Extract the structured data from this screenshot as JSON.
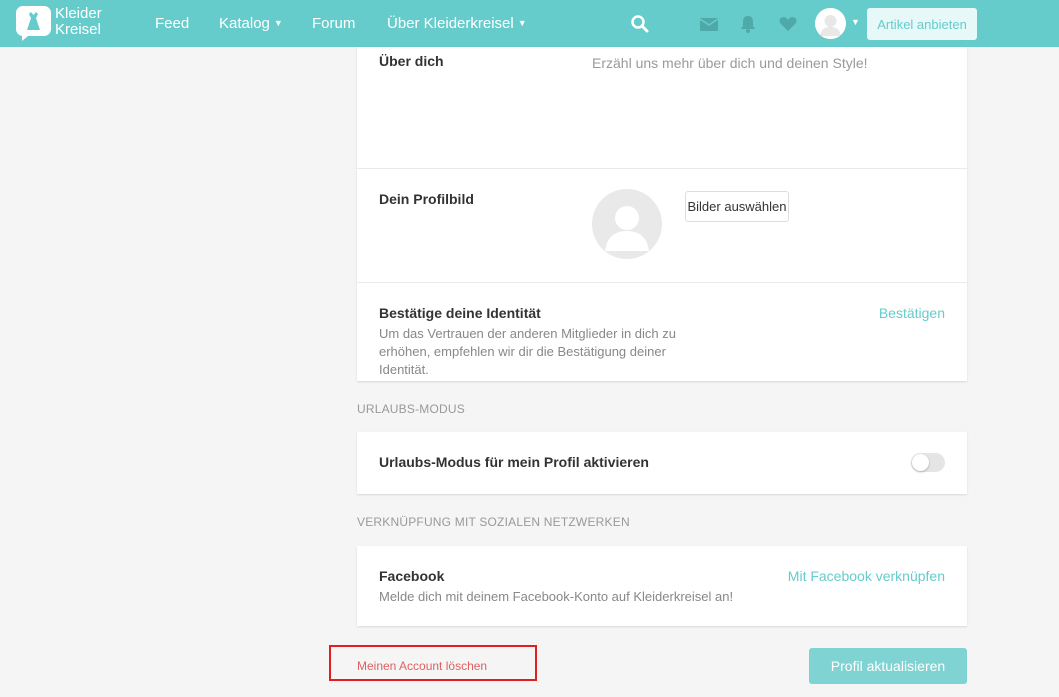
{
  "nav": {
    "logo_line1": "Kleider",
    "logo_line2": "Kreisel",
    "feed": "Feed",
    "catalog": "Katalog",
    "forum": "Forum",
    "about": "Über Kleiderkreisel",
    "sell_button": "Artikel anbieten",
    "icons": [
      "search-icon",
      "mail-icon",
      "bell-icon",
      "heart-icon"
    ]
  },
  "about": {
    "label": "Über dich",
    "placeholder": "Erzähl uns mehr über dich und deinen Style!"
  },
  "profile_picture": {
    "label": "Dein Profilbild",
    "button": "Bilder auswählen"
  },
  "identity": {
    "label": "Bestätige deine Identität",
    "description": "Um das Vertrauen der anderen Mitglieder in dich zu erhöhen, empfehlen wir dir die Bestätigung deiner Identität.",
    "link": "Bestätigen"
  },
  "vacation": {
    "section_title": "URLAUBS-MODUS",
    "label": "Urlaubs-Modus für mein Profil aktivieren",
    "enabled": false
  },
  "social": {
    "section_title": "VERKNÜPFUNG MIT SOZIALEN NETZWERKEN",
    "label": "Facebook",
    "description": "Melde dich mit deinem Facebook-Konto auf Kleiderkreisel an!",
    "link": "Mit Facebook verknüpfen"
  },
  "footer": {
    "delete_account": "Meinen Account löschen",
    "update_button": "Profil aktualisieren"
  },
  "colors": {
    "brand": "#65cccb",
    "delete_highlight": "#e02020"
  }
}
